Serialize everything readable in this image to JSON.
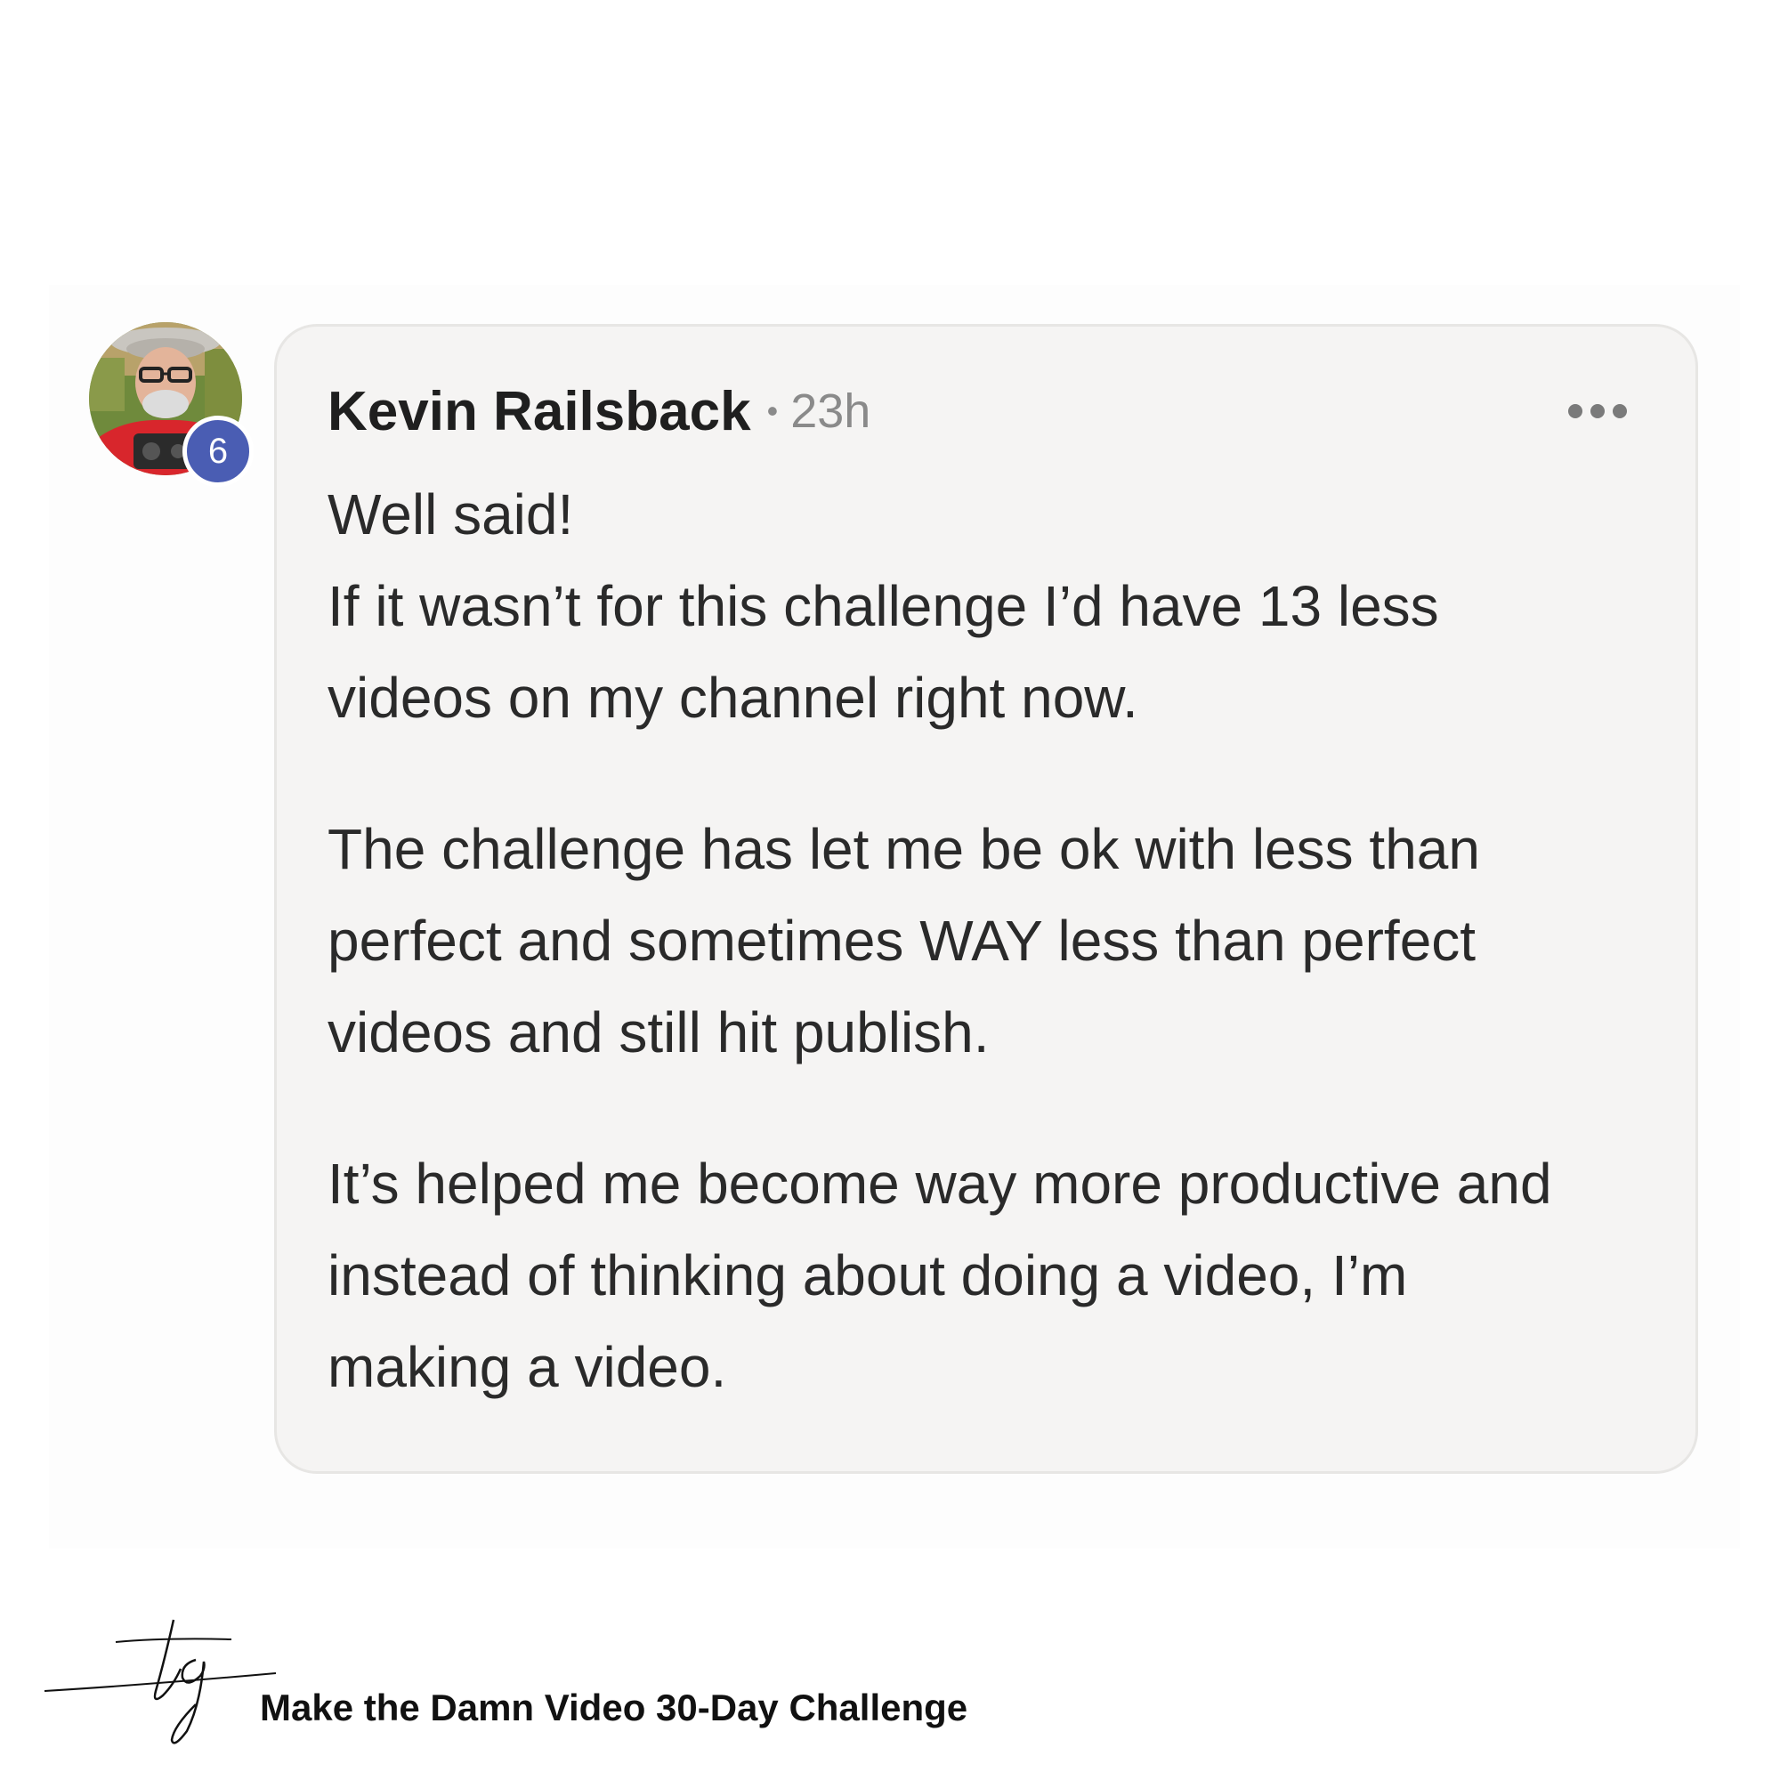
{
  "comment": {
    "author": "Kevin Railsback",
    "separator": "•",
    "timestamp": "23h",
    "level_badge": "6",
    "avatar_icon": "user-avatar-photo",
    "more_icon": "more-horizontal-icon",
    "paragraphs": [
      [
        "Well said!",
        "If it wasn’t for this challenge I’d have 13 less",
        "videos on my channel right now."
      ],
      [
        "The challenge has let me be ok with less than",
        "perfect and sometimes WAY less than perfect",
        "videos and still hit publish."
      ],
      [
        "It’s helped me become way more productive and",
        "instead of thinking about doing a video, I’m",
        "making a video."
      ]
    ]
  },
  "footer": {
    "logo_icon": "tg-signature-logo",
    "title": "Make the Damn Video 30-Day Challenge"
  },
  "colors": {
    "card_background": "#f5f4f3",
    "card_border": "#e7e6e4",
    "badge": "#4a5db3",
    "text": "#2a2a2a",
    "muted": "#8a8a8a"
  }
}
